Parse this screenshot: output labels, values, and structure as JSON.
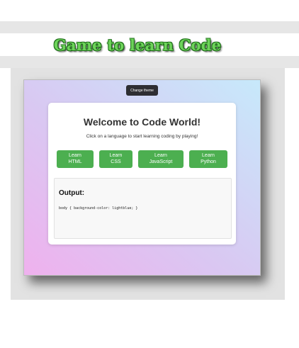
{
  "page": {
    "heading": "Game to learn Code"
  },
  "app": {
    "theme_button": "Change theme",
    "title": "Welcome to Code World!",
    "subtitle": "Click on a language to start learning coding by playing!",
    "languages": [
      {
        "line1": "Learn",
        "line2": "HTML"
      },
      {
        "line1": "Learn",
        "line2": "CSS"
      },
      {
        "line1": "Learn",
        "line2": "JavaScript"
      },
      {
        "line1": "Learn",
        "line2": "Python"
      }
    ],
    "output": {
      "title": "Output:",
      "code": "body { background-color: lightblue; }"
    }
  },
  "colors": {
    "button_green": "#4caf50",
    "heading_green": "#6dd35a",
    "theme_button_bg": "#2e2e33"
  }
}
